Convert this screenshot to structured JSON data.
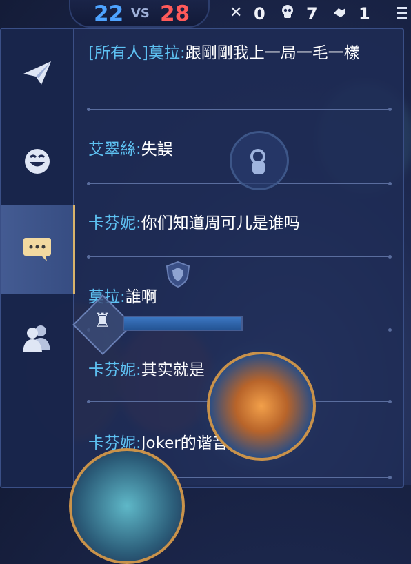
{
  "hud": {
    "score_blue": "22",
    "vs": "VS",
    "score_red": "28",
    "kills": "0",
    "deaths": "7",
    "assists": "1",
    "kills_icon": "crossed-swords-icon",
    "deaths_icon": "skull-icon",
    "assists_icon": "handshake-icon",
    "menu_icon": "menu-icon"
  },
  "sidebar": {
    "items": [
      {
        "name": "quick-message",
        "icon": "paper-plane-icon",
        "active": false
      },
      {
        "name": "emoji",
        "icon": "smile-icon",
        "active": false
      },
      {
        "name": "chat",
        "icon": "speech-bubble-icon",
        "active": true
      },
      {
        "name": "friends",
        "icon": "people-icon",
        "active": false
      }
    ]
  },
  "chat": {
    "messages": [
      {
        "sender": "[所有人]莫拉:",
        "text": "跟剛剛我上一局一毛一樣"
      },
      {
        "sender": "艾翠絲:",
        "text": "失誤"
      },
      {
        "sender": "卡芬妮:",
        "text": "你们知道周可儿是谁吗"
      },
      {
        "sender": "莫拉:",
        "text": "誰啊"
      },
      {
        "sender": "卡芬妮:",
        "text": "其实就是"
      },
      {
        "sender": "卡芬妮:",
        "text": "Joker的谐音"
      }
    ]
  },
  "colors": {
    "sender": "#5ec1f2",
    "text": "#ffffff",
    "blue_team": "#4ea3ff",
    "red_team": "#ff5a5a",
    "active_tab_accent": "#d9b36a"
  },
  "status": {
    "hp_fraction": 1.0
  }
}
